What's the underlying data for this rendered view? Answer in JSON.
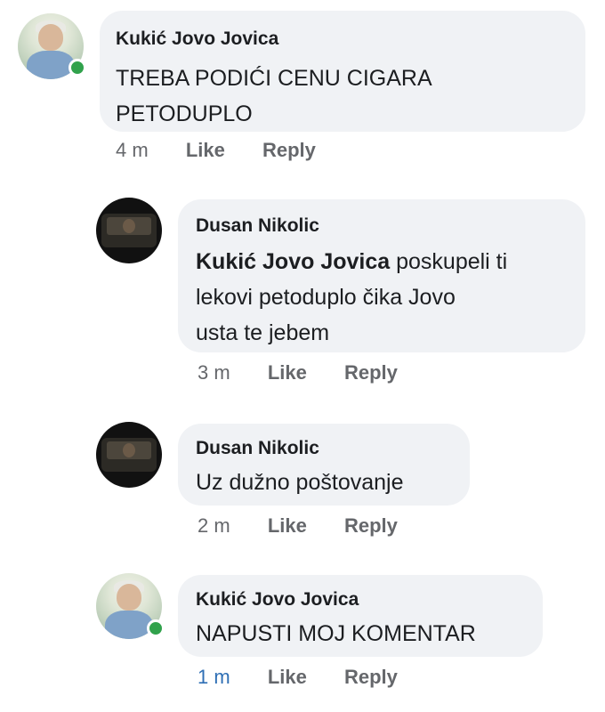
{
  "comments": [
    {
      "author": "Kukić Jovo Jovica",
      "text_lines": [
        "TREBA PODIĆI CENU CIGARA",
        "PETODUPLO"
      ],
      "time": "4 m",
      "like": "Like",
      "reply": "Reply"
    },
    {
      "author": "Dusan Nikolic",
      "mention": "Kukić Jovo Jovica",
      "text_line1_rest": " poskupeli ti",
      "text_line2": "lekovi petoduplo čika Jovo",
      "text_line3": "usta te jebem",
      "time": "3 m",
      "like": "Like",
      "reply": "Reply"
    },
    {
      "author": "Dusan Nikolic",
      "text": "Uz dužno poštovanje",
      "time": "2 m",
      "like": "Like",
      "reply": "Reply"
    },
    {
      "author": "Kukić Jovo Jovica",
      "text": "NAPUSTI MOJ KOMENTAR",
      "time": "1 m",
      "like": "Like",
      "reply": "Reply"
    }
  ],
  "colors": {
    "bubble": "#f0f2f5",
    "meta": "#65676b",
    "online": "#31a24c",
    "time_highlight": "#2f6fb5"
  }
}
